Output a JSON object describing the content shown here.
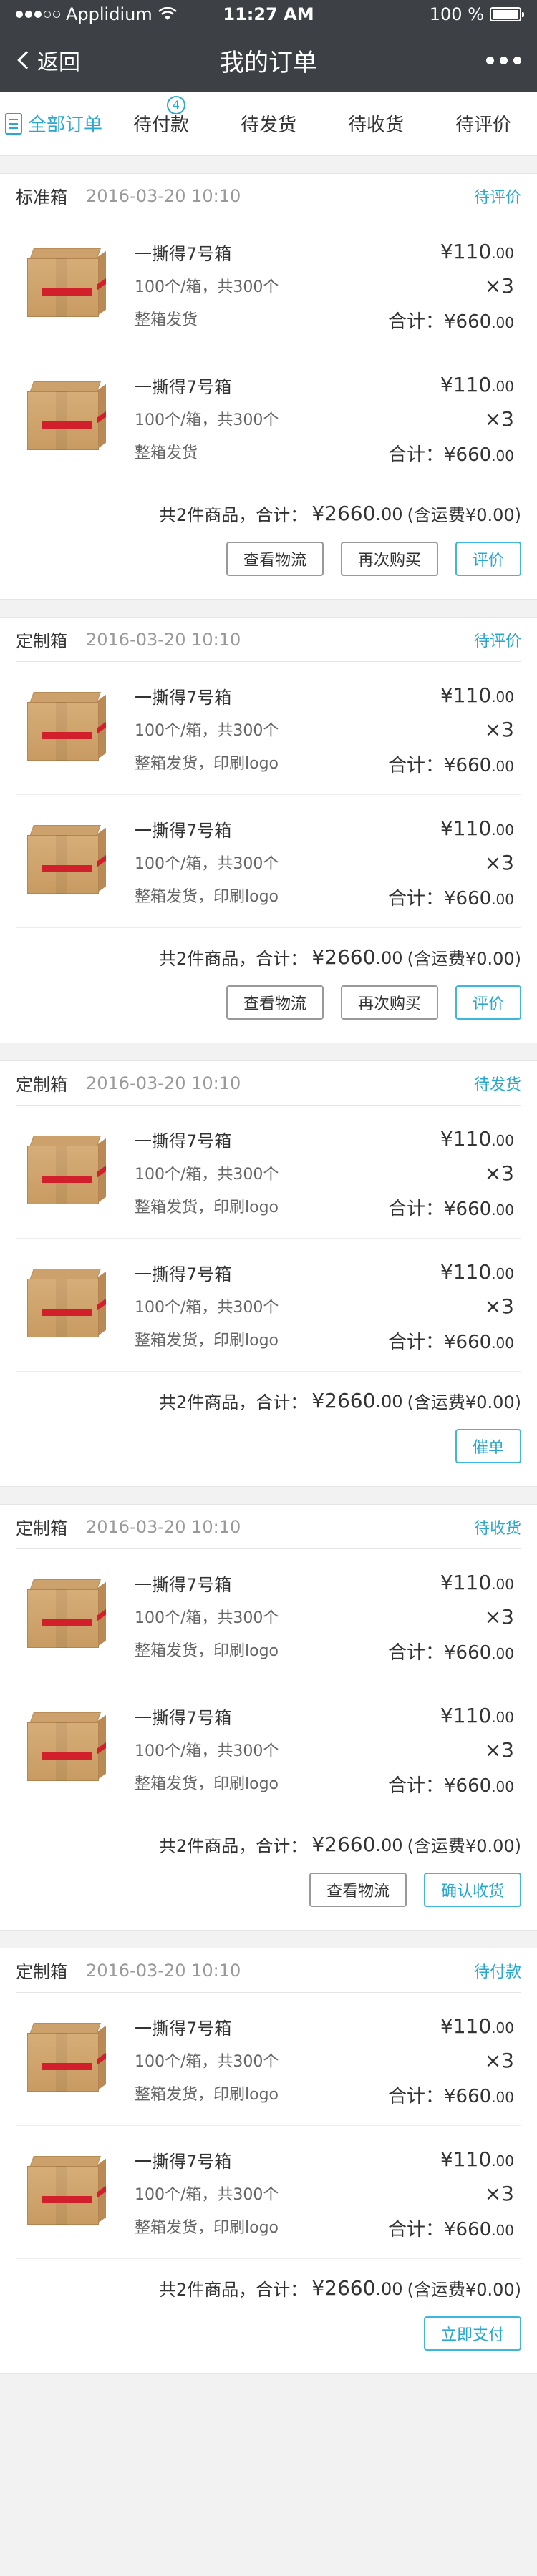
{
  "status_bar": {
    "carrier": "Applidium",
    "time": "11:27 AM",
    "battery": "100 %",
    "battery_level": 1.0
  },
  "navbar": {
    "back_label": "返回",
    "title": "我的订单"
  },
  "tabs": [
    {
      "label": "全部订单",
      "active": true
    },
    {
      "label": "待付款",
      "badge": "4"
    },
    {
      "label": "待发货"
    },
    {
      "label": "待收货"
    },
    {
      "label": "待评价"
    }
  ],
  "orders": [
    {
      "type": "标准箱",
      "time": "2016-03-20 10:10",
      "status": "待评价",
      "items": [
        {
          "name": "一撕得7号箱",
          "spec": "100个/箱，共300个",
          "note": "整箱发货",
          "price_int": "¥110",
          "price_dec": ".00",
          "qty": "×3",
          "subtotal_label": "合计：",
          "subtotal_int": "¥660",
          "subtotal_dec": ".00"
        },
        {
          "name": "一撕得7号箱",
          "spec": "100个/箱，共300个",
          "note": "整箱发货",
          "price_int": "¥110",
          "price_dec": ".00",
          "qty": "×3",
          "subtotal_label": "合计：",
          "subtotal_int": "¥660",
          "subtotal_dec": ".00"
        }
      ],
      "summary_prefix": "共2件商品，合计：",
      "total_int": "¥2660",
      "total_dec": ".00",
      "shipping": "(含运费¥0.00)",
      "buttons": [
        {
          "label": "查看物流",
          "primary": false
        },
        {
          "label": "再次购买",
          "primary": false
        },
        {
          "label": "评价",
          "primary": true
        }
      ]
    },
    {
      "type": "定制箱",
      "time": "2016-03-20 10:10",
      "status": "待评价",
      "items": [
        {
          "name": "一撕得7号箱",
          "spec": "100个/箱，共300个",
          "note": "整箱发货，印刷logo",
          "price_int": "¥110",
          "price_dec": ".00",
          "qty": "×3",
          "subtotal_label": "合计：",
          "subtotal_int": "¥660",
          "subtotal_dec": ".00"
        },
        {
          "name": "一撕得7号箱",
          "spec": "100个/箱，共300个",
          "note": "整箱发货，印刷logo",
          "price_int": "¥110",
          "price_dec": ".00",
          "qty": "×3",
          "subtotal_label": "合计：",
          "subtotal_int": "¥660",
          "subtotal_dec": ".00"
        }
      ],
      "summary_prefix": "共2件商品，合计：",
      "total_int": "¥2660",
      "total_dec": ".00",
      "shipping": "(含运费¥0.00)",
      "buttons": [
        {
          "label": "查看物流",
          "primary": false
        },
        {
          "label": "再次购买",
          "primary": false
        },
        {
          "label": "评价",
          "primary": true
        }
      ]
    },
    {
      "type": "定制箱",
      "time": "2016-03-20 10:10",
      "status": "待发货",
      "items": [
        {
          "name": "一撕得7号箱",
          "spec": "100个/箱，共300个",
          "note": "整箱发货，印刷logo",
          "price_int": "¥110",
          "price_dec": ".00",
          "qty": "×3",
          "subtotal_label": "合计：",
          "subtotal_int": "¥660",
          "subtotal_dec": ".00"
        },
        {
          "name": "一撕得7号箱",
          "spec": "100个/箱，共300个",
          "note": "整箱发货，印刷logo",
          "price_int": "¥110",
          "price_dec": ".00",
          "qty": "×3",
          "subtotal_label": "合计：",
          "subtotal_int": "¥660",
          "subtotal_dec": ".00"
        }
      ],
      "summary_prefix": "共2件商品，合计：",
      "total_int": "¥2660",
      "total_dec": ".00",
      "shipping": "(含运费¥0.00)",
      "buttons": [
        {
          "label": "催单",
          "primary": true
        }
      ]
    },
    {
      "type": "定制箱",
      "time": "2016-03-20 10:10",
      "status": "待收货",
      "items": [
        {
          "name": "一撕得7号箱",
          "spec": "100个/箱，共300个",
          "note": "整箱发货，印刷logo",
          "price_int": "¥110",
          "price_dec": ".00",
          "qty": "×3",
          "subtotal_label": "合计：",
          "subtotal_int": "¥660",
          "subtotal_dec": ".00"
        },
        {
          "name": "一撕得7号箱",
          "spec": "100个/箱，共300个",
          "note": "整箱发货，印刷logo",
          "price_int": "¥110",
          "price_dec": ".00",
          "qty": "×3",
          "subtotal_label": "合计：",
          "subtotal_int": "¥660",
          "subtotal_dec": ".00"
        }
      ],
      "summary_prefix": "共2件商品，合计：",
      "total_int": "¥2660",
      "total_dec": ".00",
      "shipping": "(含运费¥0.00)",
      "buttons": [
        {
          "label": "查看物流",
          "primary": false
        },
        {
          "label": "确认收货",
          "primary": true
        }
      ]
    },
    {
      "type": "定制箱",
      "time": "2016-03-20 10:10",
      "status": "待付款",
      "items": [
        {
          "name": "一撕得7号箱",
          "spec": "100个/箱，共300个",
          "note": "整箱发货，印刷logo",
          "price_int": "¥110",
          "price_dec": ".00",
          "qty": "×3",
          "subtotal_label": "合计：",
          "subtotal_int": "¥660",
          "subtotal_dec": ".00"
        },
        {
          "name": "一撕得7号箱",
          "spec": "100个/箱，共300个",
          "note": "整箱发货，印刷logo",
          "price_int": "¥110",
          "price_dec": ".00",
          "qty": "×3",
          "subtotal_label": "合计：",
          "subtotal_int": "¥660",
          "subtotal_dec": ".00"
        }
      ],
      "summary_prefix": "共2件商品，合计：",
      "total_int": "¥2660",
      "total_dec": ".00",
      "shipping": "(含运费¥0.00)",
      "buttons": [
        {
          "label": "立即支付",
          "primary": true
        }
      ]
    }
  ],
  "colors": {
    "header_bg": "#3d4145",
    "accent": "#27a8d0",
    "page_bg": "#f2f2f2"
  },
  "icons": [
    "signal-dots-icon",
    "wifi-icon",
    "battery-icon",
    "back-chevron-icon",
    "more-dots-icon",
    "order-list-icon",
    "box-product-image"
  ]
}
